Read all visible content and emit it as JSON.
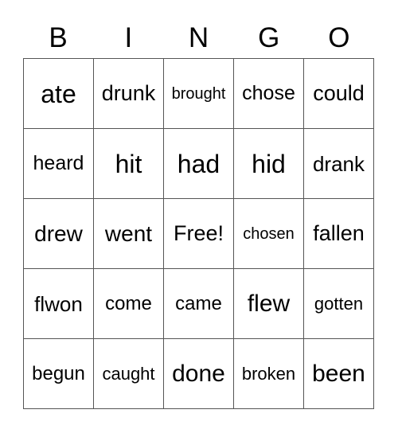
{
  "header": [
    "B",
    "I",
    "N",
    "G",
    "O"
  ],
  "cells": [
    [
      "ate",
      "drunk",
      "brought",
      "chose",
      "could"
    ],
    [
      "heard",
      "hit",
      "had",
      "hid",
      "drank"
    ],
    [
      "drew",
      "went",
      "Free!",
      "chosen",
      "fallen"
    ],
    [
      "flwon",
      "come",
      "came",
      "flew",
      "gotten"
    ],
    [
      "begun",
      "caught",
      "done",
      "broken",
      "been"
    ]
  ]
}
